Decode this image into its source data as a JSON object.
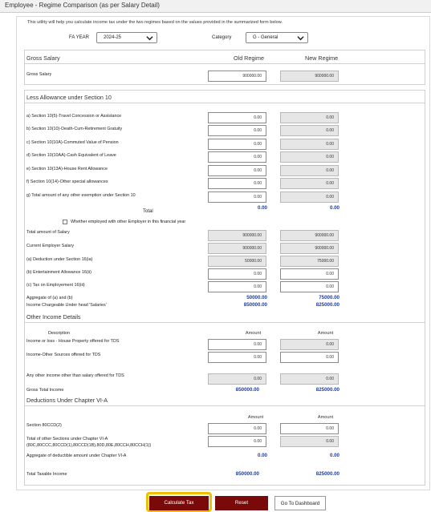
{
  "window_title": "Employee - Regime Comparison (as per Salary Detail)",
  "intro": "This utility will help you calculate income tax under the two regimes based on the values provided in the summarized form below.",
  "fa_year": {
    "label": "FA YEAR",
    "value": "2024-25"
  },
  "category": {
    "label": "Category",
    "value": "G - General"
  },
  "gross": {
    "title": "Gross Salary",
    "old_head": "Old Regime",
    "new_head": "New Regime",
    "label": "Gross Salary",
    "old": "900000.00",
    "new": "900000.00"
  },
  "allowance": {
    "title": "Less Allowance under Section 10",
    "rows": [
      {
        "label": "a) Section 10(5)-Travel Concession or Assistance",
        "old": "0.00",
        "new": "0.00"
      },
      {
        "label": "b) Section 10(10)-Death-Cum-Retirement Gratuity",
        "old": "0.00",
        "new": "0.00"
      },
      {
        "label": "c) Section 10(10A)-Commuted Value of Pension",
        "old": "0.00",
        "new": "0.00"
      },
      {
        "label": "d) Section 10(10AA)-Cash Equivalent of Leave",
        "old": "0.00",
        "new": "0.00"
      },
      {
        "label": "e) Section 10(13A)-House Rent Allowance",
        "old": "0.00",
        "new": "0.00"
      },
      {
        "label": "f) Section 10(14)-Other special allowances",
        "old": "0.00",
        "new": "0.00"
      },
      {
        "label": "g) Total amount of any other exemption under Section 10",
        "old": "0.00",
        "new": "0.00"
      }
    ],
    "total_label": "Total",
    "total_old": "0.00",
    "total_new": "0.00",
    "other_employer_label": "Whether employed with other Employer in this financial year"
  },
  "salary": {
    "rows": [
      {
        "label": "Total amount of Salary",
        "old": "900000.00",
        "new": "900000.00"
      },
      {
        "label": "Current Employer Salary",
        "old": "900000.00",
        "new": "900000.00"
      },
      {
        "label": "(a) Deduction under Section 16(ia)",
        "old": "50000.00",
        "new": "75000.00"
      },
      {
        "label": "(b) Entertainment Allowance 16(ii)",
        "old": "0.00",
        "new": "0.00"
      },
      {
        "label": "(c) Tax on Employement 16(iii)",
        "old": "0.00",
        "new": "0.00"
      }
    ],
    "aggregate_label": "Aggregate of (a) and (b)",
    "aggregate_old": "50000.00",
    "aggregate_new": "75000.00",
    "chargeable_label": "Income Chargeable Under head 'Salaries'",
    "chargeable_old": "850000.00",
    "chargeable_new": "825000.00"
  },
  "other_income": {
    "title": "Other Income Details",
    "desc_head": "Description",
    "amt_head_old": "Amount",
    "amt_head_new": "Amount",
    "rows": [
      {
        "label": "Income or loss - House Property offered for TDS",
        "old": "0.00",
        "new": "0.00"
      },
      {
        "label": "Income-Other Sources offered for TDS",
        "old": "0.00",
        "new": "0.00"
      },
      {
        "label": "Any other income other than salary offered for TDS",
        "old": "0.00",
        "new": "0.00"
      }
    ],
    "gross_total_label": "Gross Total Income",
    "gross_total_old": "850000.00",
    "gross_total_new": "825000.00"
  },
  "chapter6a": {
    "title": "Deductions Under Chapter VI-A",
    "amt_head_old": "Amount",
    "amt_head_new": "Amount",
    "row1_label": "Section 80CCD(2)",
    "row1_old": "0.00",
    "row1_new": "0.00",
    "row2_label_1": "Total of other Sections under Chapter VI-A",
    "row2_label_2": "(80C,80CCC,80CCD(1),80CCD(1B),80D,80E,80CCH,80CCH(1))",
    "row2_old": "0.00",
    "row2_new": "0.00",
    "aggregate_label": "Aggregate of deductible amount under Chapter VI-A",
    "aggregate_old": "0.00",
    "aggregate_new": "0.00"
  },
  "taxable": {
    "label": "Total Taxable Income",
    "old": "850000.00",
    "new": "825000.00"
  },
  "buttons": {
    "calculate": "Calculate Tax",
    "reset": "Reset",
    "dashboard": "Go To Dashboard"
  },
  "colors": {
    "accent_value": "#1f3d99",
    "button_dark": "#7a0a0a",
    "highlight": "#f0c000"
  }
}
